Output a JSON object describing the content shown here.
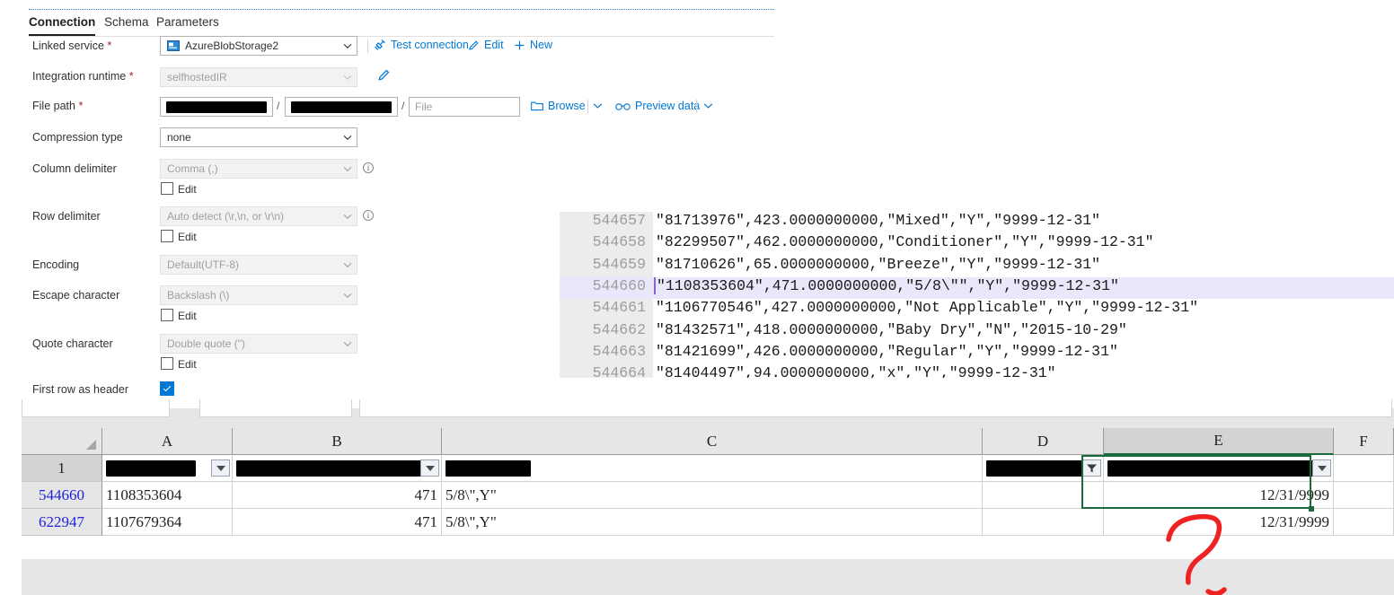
{
  "adf": {
    "tabs": [
      {
        "label": "Connection",
        "active": true
      },
      {
        "label": "Schema",
        "active": false
      },
      {
        "label": "Parameters",
        "active": false
      }
    ],
    "fields": {
      "linked_service": {
        "label": "Linked service",
        "required": "*",
        "value": "AzureBlobStorage2",
        "icon": "azure-blob-storage-icon"
      },
      "integration_runtime": {
        "label": "Integration runtime",
        "required": "*",
        "value": "selfhostedIR",
        "disabled": true
      },
      "file_path": {
        "label": "File path",
        "required": "*",
        "container_value": "",
        "directory_value": "",
        "file_placeholder": "File"
      },
      "compression_type": {
        "label": "Compression type",
        "value": "none"
      },
      "column_delimiter": {
        "label": "Column delimiter",
        "value": "Comma (,)"
      },
      "row_delimiter": {
        "label": "Row delimiter",
        "value": "Auto detect (\\r,\\n, or \\r\\n)"
      },
      "encoding": {
        "label": "Encoding",
        "value": "Default(UTF-8)"
      },
      "escape_character": {
        "label": "Escape character",
        "value": "Backslash (\\)"
      },
      "quote_character": {
        "label": "Quote character",
        "value": "Double quote (\")"
      },
      "first_row_as_header": {
        "label": "First row as header",
        "checked": true
      }
    },
    "edit_checkbox_label": "Edit",
    "commands": {
      "test_connection": "Test connection",
      "edit": "Edit",
      "new": "New",
      "browse": "Browse",
      "preview_data": "Preview data"
    }
  },
  "editor": {
    "lines": [
      {
        "number": "544657",
        "text": "\"81713976\",423.0000000000,\"Mixed\",\"Y\",\"9999-12-31\"",
        "highlighted": false
      },
      {
        "number": "544658",
        "text": "\"82299507\",462.0000000000,\"Conditioner\",\"Y\",\"9999-12-31\"",
        "highlighted": false
      },
      {
        "number": "544659",
        "text": "\"81710626\",65.0000000000,\"Breeze\",\"Y\",\"9999-12-31\"",
        "highlighted": false
      },
      {
        "number": "544660",
        "text": "\"1108353604\",471.0000000000,\"5/8\\\"\",\"Y\",\"9999-12-31\"",
        "highlighted": true
      },
      {
        "number": "544661",
        "text": "\"1106770546\",427.0000000000,\"Not Applicable\",\"Y\",\"9999-12-31\"",
        "highlighted": false
      },
      {
        "number": "544662",
        "text": "\"81432571\",418.0000000000,\"Baby Dry\",\"N\",\"2015-10-29\"",
        "highlighted": false
      },
      {
        "number": "544663",
        "text": "\"81421699\",426.0000000000,\"Regular\",\"Y\",\"9999-12-31\"",
        "highlighted": false
      },
      {
        "number": "544664",
        "text": "\"81404497\",94.0000000000,\"x\",\"Y\",\"9999-12-31\"",
        "highlighted": false
      }
    ]
  },
  "excel": {
    "column_headers": [
      "A",
      "B",
      "C",
      "D",
      "E",
      "F"
    ],
    "selected_column": "E",
    "header_row_number": "1",
    "header_row_cells": [
      "",
      "",
      "",
      "",
      "",
      ""
    ],
    "rows": [
      {
        "row_number": "544660",
        "cells": [
          "1108353604",
          "471",
          "5/8\\\",Y\"",
          "",
          "12/31/9999",
          "",
          ""
        ]
      },
      {
        "row_number": "622947",
        "cells": [
          "1107679364",
          "471",
          "5/8\\\",Y\"",
          "",
          "12/31/9999",
          "",
          ""
        ]
      }
    ],
    "filter_state": {
      "D": "filtered",
      "A": "dropdown",
      "B": "dropdown",
      "E": "dropdown"
    },
    "annotation": {
      "name": "red-question-mark",
      "color": "#ee2222"
    },
    "selection_color": "#1b6b3a"
  }
}
